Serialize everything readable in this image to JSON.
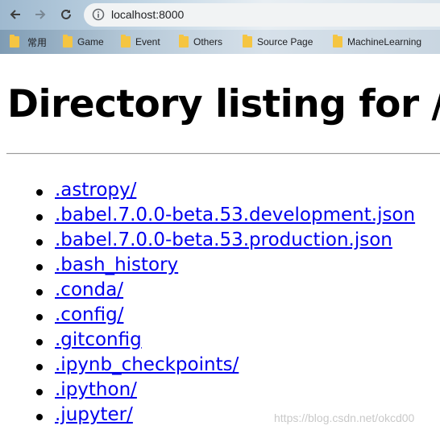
{
  "browser": {
    "address": "localhost:8000",
    "bookmarks": [
      {
        "label": "常用"
      },
      {
        "label": "Game"
      },
      {
        "label": "Event"
      },
      {
        "label": "Others"
      },
      {
        "label": "Source Page"
      },
      {
        "label": "MachineLearning"
      }
    ]
  },
  "page": {
    "title": "Directory listing for /",
    "entries": [
      ".astropy/",
      ".babel.7.0.0-beta.53.development.json",
      ".babel.7.0.0-beta.53.production.json",
      ".bash_history",
      ".conda/",
      ".config/",
      ".gitconfig",
      ".ipynb_checkpoints/",
      ".ipython/",
      ".jupyter/"
    ]
  },
  "watermark": "https://blog.csdn.net/okcd00",
  "colors": {
    "link": "#0000ee",
    "folder": "#f5c542"
  }
}
